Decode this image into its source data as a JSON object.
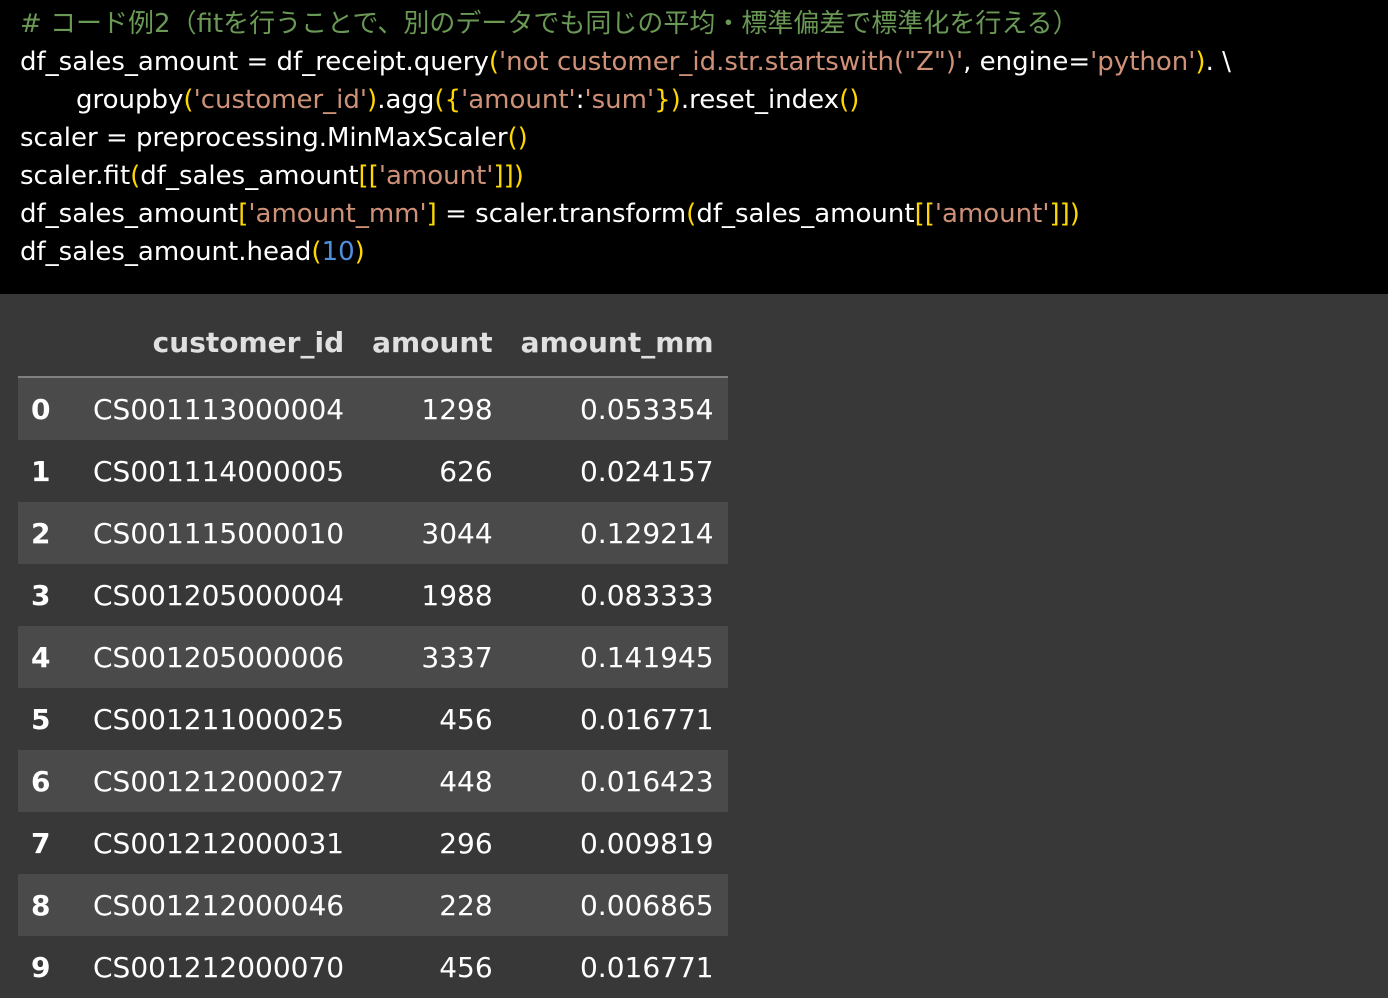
{
  "code": {
    "comment": "# コード例2（fitを行うことで、別のデータでも同じの平均・標準偏差で標準化を行える）",
    "l1": {
      "a": "df_sales_amount = df_receipt.query",
      "b": "(",
      "c": "'not customer_id.str.startswith(\"Z\")'",
      "d": ", engine=",
      "e": "'python'",
      "f": ")",
      "g": ". \\"
    },
    "l2": {
      "a": "groupby",
      "b": "(",
      "c": "'customer_id'",
      "d": ")",
      "e": ".agg",
      "f": "({",
      "g": "'amount'",
      "h": ":",
      "i": "'sum'",
      "j": "})",
      "k": ".reset_index",
      "l": "()"
    },
    "l3": {
      "a": "scaler = preprocessing.MinMaxScaler",
      "b": "()"
    },
    "l4": {
      "a": "scaler.fit",
      "b": "(",
      "c": "df_sales_amount",
      "d": "[[",
      "e": "'amount'",
      "f": "]])"
    },
    "l5": {
      "a": "df_sales_amount",
      "b": "[",
      "c": "'amount_mm'",
      "d": "]",
      "e": " = scaler.transform",
      "f": "(",
      "g": "df_sales_amount",
      "h": "[[",
      "i": "'amount'",
      "j": "]])"
    },
    "l6": {
      "a": "df_sales_amount.head",
      "b": "(",
      "c": "10",
      "d": ")"
    }
  },
  "table": {
    "columns": [
      "",
      "customer_id",
      "amount",
      "amount_mm"
    ],
    "rows": [
      {
        "index": "0",
        "customer_id": "CS001113000004",
        "amount": "1298",
        "amount_mm": "0.053354"
      },
      {
        "index": "1",
        "customer_id": "CS001114000005",
        "amount": "626",
        "amount_mm": "0.024157"
      },
      {
        "index": "2",
        "customer_id": "CS001115000010",
        "amount": "3044",
        "amount_mm": "0.129214"
      },
      {
        "index": "3",
        "customer_id": "CS001205000004",
        "amount": "1988",
        "amount_mm": "0.083333"
      },
      {
        "index": "4",
        "customer_id": "CS001205000006",
        "amount": "3337",
        "amount_mm": "0.141945"
      },
      {
        "index": "5",
        "customer_id": "CS001211000025",
        "amount": "456",
        "amount_mm": "0.016771"
      },
      {
        "index": "6",
        "customer_id": "CS001212000027",
        "amount": "448",
        "amount_mm": "0.016423"
      },
      {
        "index": "7",
        "customer_id": "CS001212000031",
        "amount": "296",
        "amount_mm": "0.009819"
      },
      {
        "index": "8",
        "customer_id": "CS001212000046",
        "amount": "228",
        "amount_mm": "0.006865"
      },
      {
        "index": "9",
        "customer_id": "CS001212000070",
        "amount": "456",
        "amount_mm": "0.016771"
      }
    ]
  },
  "colors": {
    "code_bg": "#000000",
    "output_bg": "#383838",
    "row_stripe": "#4a4a4a",
    "comment": "#6a9955",
    "string": "#ce9178",
    "bracket": "#ffd700",
    "number": "#4f8fdc"
  }
}
